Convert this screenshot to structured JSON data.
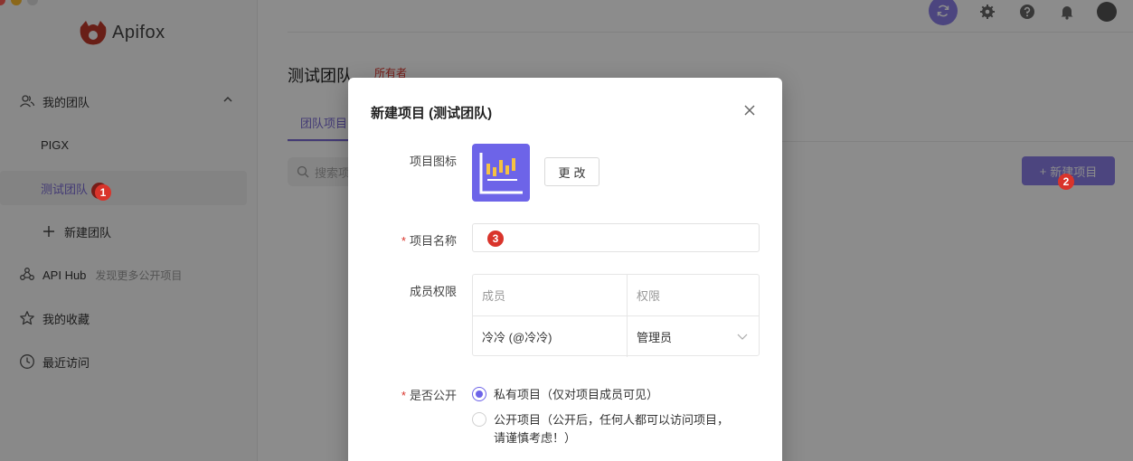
{
  "app": {
    "logo_text": "Apifox"
  },
  "sidebar": {
    "my_team_label": "我的团队",
    "teams": [
      "PIGX",
      "测试团队"
    ],
    "new_team_label": "新建团队",
    "api_hub_label": "API Hub",
    "api_hub_hint": "发现更多公开项目",
    "favorites_label": "我的收藏",
    "recent_label": "最近访问"
  },
  "main": {
    "team_title": "测试团队",
    "team_role": "所有者",
    "tab_label": "团队项目",
    "search_placeholder": "搜索项",
    "new_project_button": "新建项目"
  },
  "badges": {
    "one": "1",
    "two": "2",
    "three": "3"
  },
  "modal": {
    "title": "新建项目 (测试团队)",
    "icon_label": "项目图标",
    "change_button": "更改",
    "name_label": "项目名称",
    "name_value": "",
    "permissions_label": "成员权限",
    "perm_headers": {
      "member": "成员",
      "role": "权限"
    },
    "perm_rows": [
      {
        "member": "冷冷 (@冷冷)",
        "role": "管理员"
      }
    ],
    "public_label": "是否公开",
    "options": {
      "private": "私有项目（仅对项目成员可见）",
      "public": "公开项目（公开后，任何人都可以访问项目，请谨慎考虑！）"
    },
    "selected_option": "private"
  },
  "colors": {
    "accent": "#6d64e8",
    "badge": "#d9342b",
    "logo": "#c0392b"
  }
}
